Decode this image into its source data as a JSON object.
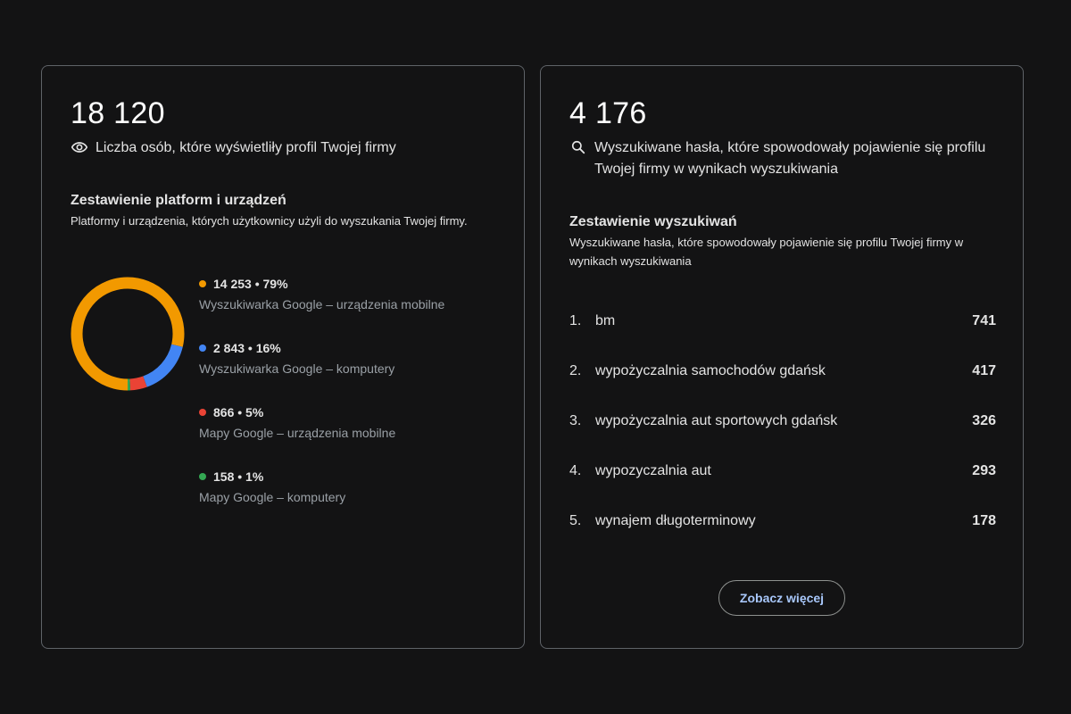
{
  "profile_views": {
    "total": "18 120",
    "description": "Liczba osób, które wyświetliły profil Twojej firmy",
    "icon": "eye-icon",
    "breakdown_title": "Zestawienie platform i urządzeń",
    "breakdown_desc": "Platformy i urządzenia, których użytkownicy użyli do wyszukania Twojej firmy.",
    "items": [
      {
        "stat": "14 253 • 79%",
        "label": "Wyszukiwarka Google – urządzenia mobilne",
        "color": "#f29900",
        "value": 14253
      },
      {
        "stat": "2 843 • 16%",
        "label": "Wyszukiwarka Google – komputery",
        "color": "#4285f4",
        "value": 2843
      },
      {
        "stat": "866 • 5%",
        "label": "Mapy Google – urządzenia mobilne",
        "color": "#ea4335",
        "value": 866
      },
      {
        "stat": "158 • 1%",
        "label": "Mapy Google – komputery",
        "color": "#34a853",
        "value": 158
      }
    ]
  },
  "searches": {
    "total": "4 176",
    "description": "Wyszukiwane hasła, które spowodowały pojawienie się profilu Twojej firmy w wynikach wyszukiwania",
    "icon": "search-icon",
    "breakdown_title": "Zestawienie wyszukiwań",
    "breakdown_desc": "Wyszukiwane hasła, które spowodowały pojawienie się profilu Twojej firmy w wynikach wyszukiwania",
    "queries": [
      {
        "rank": "1.",
        "term": "bm",
        "count": "741"
      },
      {
        "rank": "2.",
        "term": "wypożyczalnia samochodów gdańsk",
        "count": "417"
      },
      {
        "rank": "3.",
        "term": "wypożyczalnia aut sportowych gdańsk",
        "count": "326"
      },
      {
        "rank": "4.",
        "term": "wypozyczalnia aut",
        "count": "293"
      },
      {
        "rank": "5.",
        "term": "wynajem długoterminowy",
        "count": "178"
      }
    ],
    "more_label": "Zobacz więcej"
  }
}
